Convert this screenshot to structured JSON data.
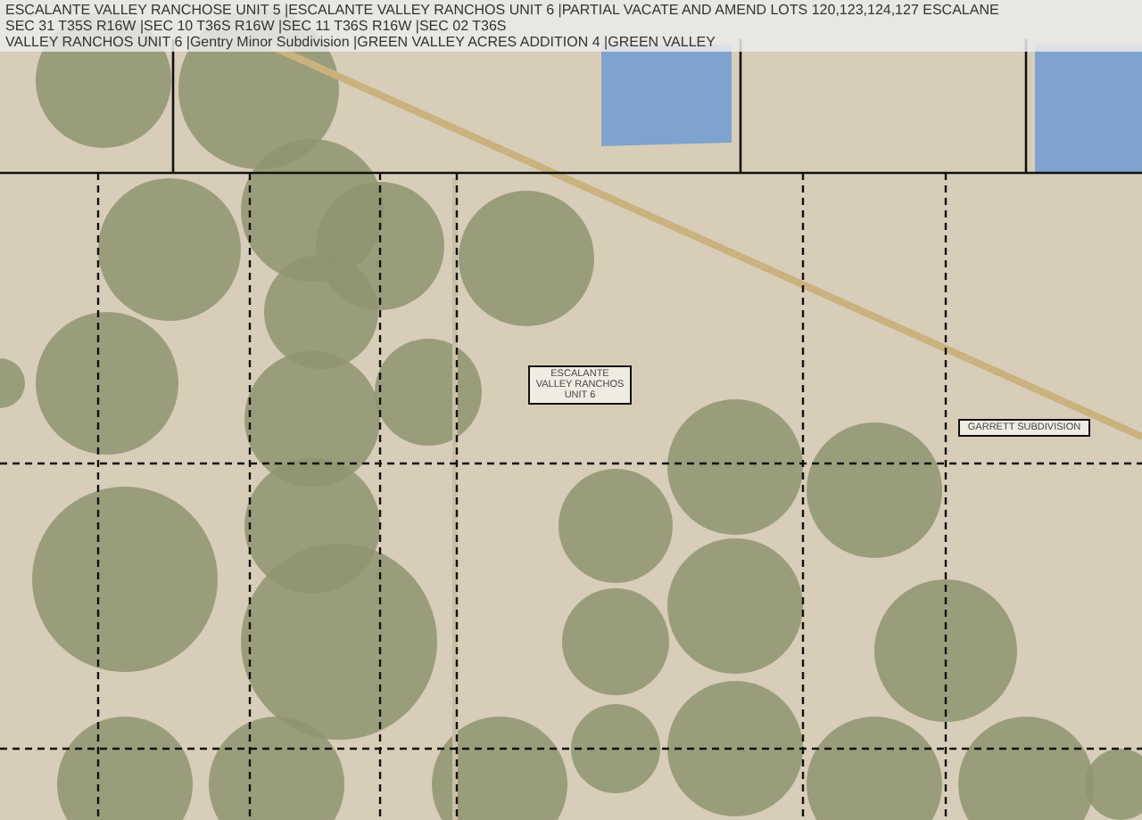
{
  "map": {
    "header_lines": [
      "ESCALANTE VALLEY RANCHOSE UNIT 5 |ESCALANTE VALLEY RANCHOS UNIT 6 |PARTIAL VACATE AND AMEND LOTS 120,123,124,127 ESCALANE",
      "SEC 31 T35S R16W |SEC 10 T36S R16W |SEC 11 T36S R16W |SEC 02 T36S",
      "VALLEY RANCHOS UNIT 6 |Gentry Minor Subdivision |GREEN VALLEY ACRES ADDITION 4 |GREEN VALLEY"
    ],
    "labels": [
      {
        "text": "ESCALANTE VALLEY RANCHOS UNIT 6"
      },
      {
        "text": "GARRETT SUBDIVISION"
      }
    ]
  }
}
